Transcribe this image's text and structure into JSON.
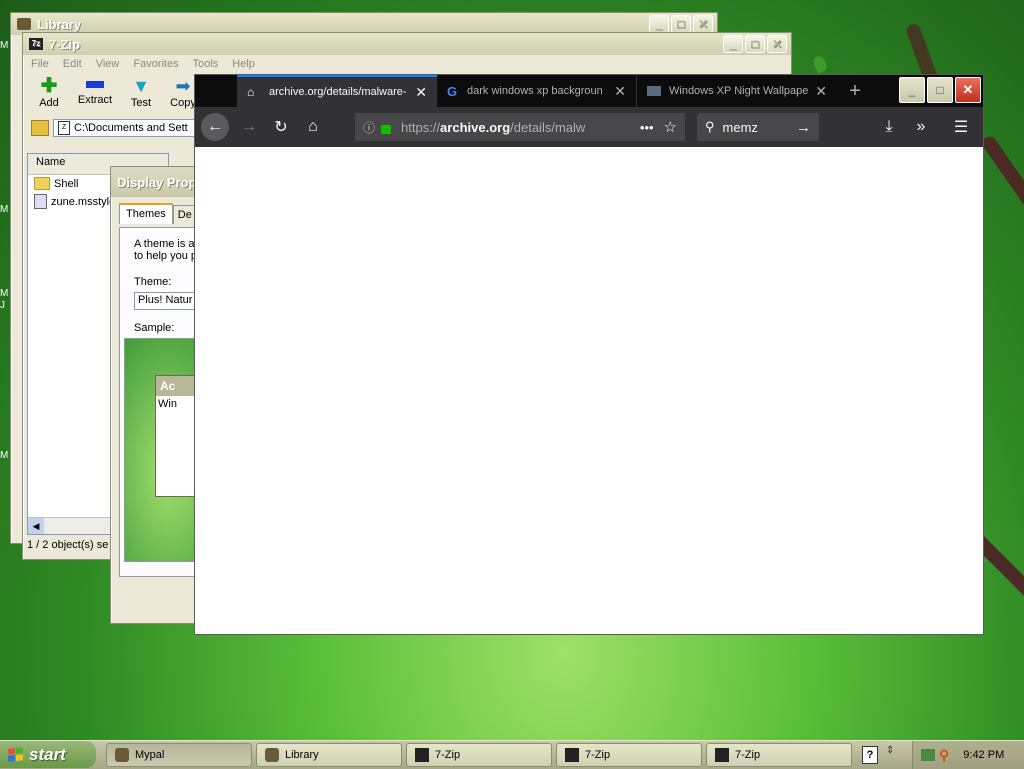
{
  "desktop": {
    "side_letters": [
      "M",
      "M",
      "M",
      "J",
      "M"
    ]
  },
  "library_window": {
    "title": "Library"
  },
  "zip_window": {
    "title": "7-Zip",
    "menu": [
      "File",
      "Edit",
      "View",
      "Favorites",
      "Tools",
      "Help"
    ],
    "toolbar": [
      "Add",
      "Extract",
      "Test",
      "Copy"
    ],
    "path": "C:\\Documents and Sett",
    "column_name": "Name",
    "files": [
      "Shell",
      "zune.msstyle"
    ],
    "status": "1 / 2 object(s) se"
  },
  "display_props": {
    "title": "Display Prop",
    "tabs": [
      "Themes",
      "De"
    ],
    "desc_line1": "A theme is a",
    "desc_line2": "to help you p",
    "theme_label": "Theme:",
    "theme_value": "Plus! Natur",
    "sample_label": "Sample:",
    "sample_win_title": "Ac",
    "sample_win_text": "Win"
  },
  "firefox": {
    "tabs": [
      {
        "label": "archive.org/details/malware-",
        "icon": "archive-icon"
      },
      {
        "label": "dark windows xp backgroun",
        "icon": "google-icon"
      },
      {
        "label": "Windows XP Night Wallpape",
        "icon": "page-icon"
      }
    ],
    "url_prefix": "https://",
    "url_domain": "archive.org",
    "url_path": "/details/malw",
    "search_value": "memz",
    "colors": {
      "chrome": "#0c0c0d",
      "toolbar": "#323234",
      "accent": "#0a84ff"
    }
  },
  "taskbar": {
    "start_label": "start",
    "buttons": [
      "Mypal",
      "Library",
      "7-Zip",
      "7-Zip",
      "7-Zip"
    ],
    "clock": "9:42 PM"
  }
}
